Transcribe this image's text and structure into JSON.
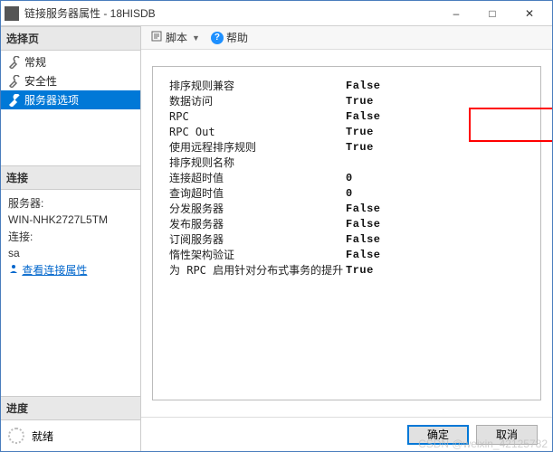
{
  "window": {
    "title": "链接服务器属性 - 18HISDB"
  },
  "sidebar": {
    "select_page_header": "选择页",
    "items": [
      {
        "label": "常规"
      },
      {
        "label": "安全性"
      },
      {
        "label": "服务器选项"
      }
    ],
    "connection_header": "连接",
    "connection": {
      "server_label": "服务器:",
      "server_value": "WIN-NHK2727L5TM",
      "conn_label": "连接:",
      "conn_value": "sa",
      "view_link": "查看连接属性"
    },
    "progress_header": "进度",
    "progress_status": "就绪"
  },
  "toolbar": {
    "script_label": "脚本",
    "help_label": "帮助"
  },
  "properties": [
    {
      "label": "排序规则兼容",
      "value": "False"
    },
    {
      "label": "数据访问",
      "value": "True"
    },
    {
      "label": "RPC",
      "value": "False"
    },
    {
      "label": "RPC Out",
      "value": "True"
    },
    {
      "label": "使用远程排序规则",
      "value": "True"
    },
    {
      "label": "排序规则名称",
      "value": ""
    },
    {
      "label": "连接超时值",
      "value": "0"
    },
    {
      "label": "查询超时值",
      "value": "0"
    },
    {
      "label": "分发服务器",
      "value": "False"
    },
    {
      "label": "发布服务器",
      "value": "False"
    },
    {
      "label": "订阅服务器",
      "value": "False"
    },
    {
      "label": "惰性架构验证",
      "value": "False"
    },
    {
      "label": "为 RPC 启用针对分布式事务的提升",
      "value": "True"
    }
  ],
  "footer": {
    "ok": "确定",
    "cancel": "取消"
  },
  "watermark": "CSDN @weixin_42125782"
}
